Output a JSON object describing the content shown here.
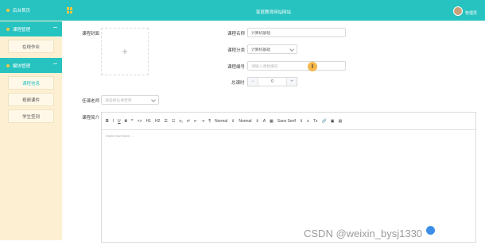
{
  "header": {
    "site_title": "家庭教育网站网站",
    "user_name": "管理员"
  },
  "sidebar": {
    "top_label": "后台首页",
    "groups": [
      {
        "label": "课程管理",
        "items": [
          "在线作业"
        ]
      },
      {
        "label": "模块管理",
        "items": [
          "课程信息",
          "视频课件",
          "学生签到"
        ]
      }
    ]
  },
  "form": {
    "cover_label": "课程封面",
    "upload_plus": "+",
    "name_label": "课程名称",
    "name_value": "计算机基础",
    "category_label": "课程分类",
    "category_value": "计算机基础",
    "code_label": "课程编号",
    "code_placeholder": "请输入课程编号",
    "hours_label": "总课时",
    "hours_value": "0",
    "minus": "−",
    "plus": "+",
    "teacher_label": "任课老师",
    "teacher_placeholder": "请选择任课老师",
    "intro_label": "课程简介"
  },
  "editor": {
    "toolbar": [
      "B",
      "I",
      "U",
      "S",
      "❞",
      "<>",
      "H1",
      "H2",
      "☰",
      "☷",
      "x₂",
      "x²",
      "⇤",
      "⇥",
      "¶",
      "Normal",
      "⇕",
      "Normal",
      "⇕",
      "A",
      "▦",
      "Sans Serif",
      "⇕",
      "≡",
      "Tx",
      "🔗",
      "▣",
      "▤"
    ],
    "placeholder": "Insert text here ..."
  },
  "watermark": "CSDN @weixin_bysj1330",
  "cursor_icon": "text-cursor-icon",
  "colors": {
    "primary": "#27c3c0",
    "sidebar_bg": "#fdf0d2",
    "accent": "#f5c842"
  }
}
